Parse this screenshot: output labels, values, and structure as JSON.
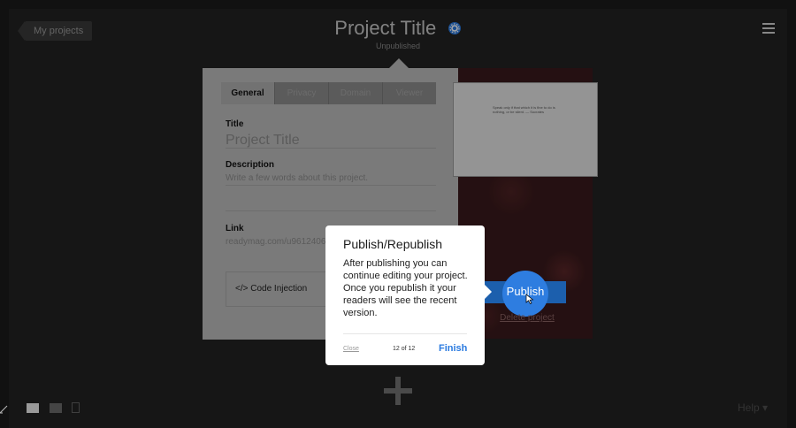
{
  "header": {
    "back_label": "My projects",
    "project_title": "Project Title",
    "status": "Unpublished"
  },
  "settings": {
    "tabs": [
      "General",
      "Privacy",
      "Domain",
      "Viewer"
    ],
    "title_label": "Title",
    "title_value": "Project Title",
    "description_label": "Description",
    "description_placeholder": "Write a few words about this project.",
    "link_label": "Link",
    "link_value": "readymag.com/u9612406",
    "code_injection_label": "</> Code Injection"
  },
  "preview": {
    "thumb_text": "Speak only if that which it is fine to do is nothing, or be silent. — Socrates",
    "publish_label": "Publish",
    "delete_label": "Delete project"
  },
  "tooltip": {
    "title": "Publish/Republish",
    "body": "After publishing you can continue editing your project. Once you republish it your readers will see the recent version.",
    "close_label": "Close",
    "step": "12 of 12",
    "finish_label": "Finish"
  },
  "footer": {
    "help_label": "Help"
  },
  "colors": {
    "accent": "#2a7ae0",
    "publish_bar": "#1c5fad",
    "background": "#222222"
  }
}
